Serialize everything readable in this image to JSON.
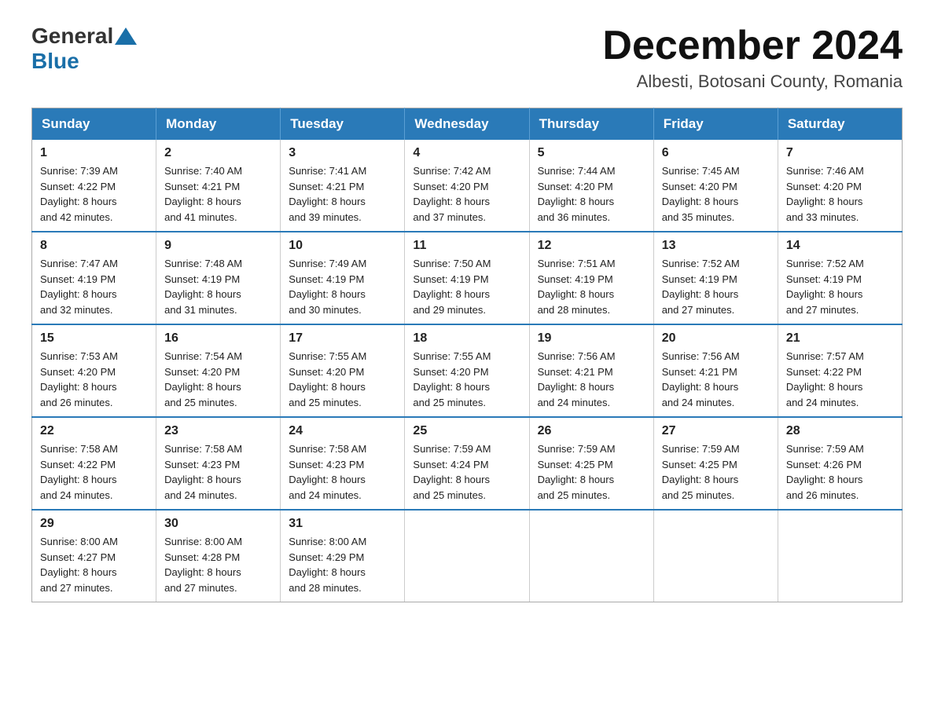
{
  "header": {
    "logo_general": "General",
    "logo_blue": "Blue",
    "month_title": "December 2024",
    "location": "Albesti, Botosani County, Romania"
  },
  "weekdays": [
    "Sunday",
    "Monday",
    "Tuesday",
    "Wednesday",
    "Thursday",
    "Friday",
    "Saturday"
  ],
  "weeks": [
    [
      {
        "day": "1",
        "sunrise": "7:39 AM",
        "sunset": "4:22 PM",
        "daylight": "8 hours and 42 minutes."
      },
      {
        "day": "2",
        "sunrise": "7:40 AM",
        "sunset": "4:21 PM",
        "daylight": "8 hours and 41 minutes."
      },
      {
        "day": "3",
        "sunrise": "7:41 AM",
        "sunset": "4:21 PM",
        "daylight": "8 hours and 39 minutes."
      },
      {
        "day": "4",
        "sunrise": "7:42 AM",
        "sunset": "4:20 PM",
        "daylight": "8 hours and 37 minutes."
      },
      {
        "day": "5",
        "sunrise": "7:44 AM",
        "sunset": "4:20 PM",
        "daylight": "8 hours and 36 minutes."
      },
      {
        "day": "6",
        "sunrise": "7:45 AM",
        "sunset": "4:20 PM",
        "daylight": "8 hours and 35 minutes."
      },
      {
        "day": "7",
        "sunrise": "7:46 AM",
        "sunset": "4:20 PM",
        "daylight": "8 hours and 33 minutes."
      }
    ],
    [
      {
        "day": "8",
        "sunrise": "7:47 AM",
        "sunset": "4:19 PM",
        "daylight": "8 hours and 32 minutes."
      },
      {
        "day": "9",
        "sunrise": "7:48 AM",
        "sunset": "4:19 PM",
        "daylight": "8 hours and 31 minutes."
      },
      {
        "day": "10",
        "sunrise": "7:49 AM",
        "sunset": "4:19 PM",
        "daylight": "8 hours and 30 minutes."
      },
      {
        "day": "11",
        "sunrise": "7:50 AM",
        "sunset": "4:19 PM",
        "daylight": "8 hours and 29 minutes."
      },
      {
        "day": "12",
        "sunrise": "7:51 AM",
        "sunset": "4:19 PM",
        "daylight": "8 hours and 28 minutes."
      },
      {
        "day": "13",
        "sunrise": "7:52 AM",
        "sunset": "4:19 PM",
        "daylight": "8 hours and 27 minutes."
      },
      {
        "day": "14",
        "sunrise": "7:52 AM",
        "sunset": "4:19 PM",
        "daylight": "8 hours and 27 minutes."
      }
    ],
    [
      {
        "day": "15",
        "sunrise": "7:53 AM",
        "sunset": "4:20 PM",
        "daylight": "8 hours and 26 minutes."
      },
      {
        "day": "16",
        "sunrise": "7:54 AM",
        "sunset": "4:20 PM",
        "daylight": "8 hours and 25 minutes."
      },
      {
        "day": "17",
        "sunrise": "7:55 AM",
        "sunset": "4:20 PM",
        "daylight": "8 hours and 25 minutes."
      },
      {
        "day": "18",
        "sunrise": "7:55 AM",
        "sunset": "4:20 PM",
        "daylight": "8 hours and 25 minutes."
      },
      {
        "day": "19",
        "sunrise": "7:56 AM",
        "sunset": "4:21 PM",
        "daylight": "8 hours and 24 minutes."
      },
      {
        "day": "20",
        "sunrise": "7:56 AM",
        "sunset": "4:21 PM",
        "daylight": "8 hours and 24 minutes."
      },
      {
        "day": "21",
        "sunrise": "7:57 AM",
        "sunset": "4:22 PM",
        "daylight": "8 hours and 24 minutes."
      }
    ],
    [
      {
        "day": "22",
        "sunrise": "7:58 AM",
        "sunset": "4:22 PM",
        "daylight": "8 hours and 24 minutes."
      },
      {
        "day": "23",
        "sunrise": "7:58 AM",
        "sunset": "4:23 PM",
        "daylight": "8 hours and 24 minutes."
      },
      {
        "day": "24",
        "sunrise": "7:58 AM",
        "sunset": "4:23 PM",
        "daylight": "8 hours and 24 minutes."
      },
      {
        "day": "25",
        "sunrise": "7:59 AM",
        "sunset": "4:24 PM",
        "daylight": "8 hours and 25 minutes."
      },
      {
        "day": "26",
        "sunrise": "7:59 AM",
        "sunset": "4:25 PM",
        "daylight": "8 hours and 25 minutes."
      },
      {
        "day": "27",
        "sunrise": "7:59 AM",
        "sunset": "4:25 PM",
        "daylight": "8 hours and 25 minutes."
      },
      {
        "day": "28",
        "sunrise": "7:59 AM",
        "sunset": "4:26 PM",
        "daylight": "8 hours and 26 minutes."
      }
    ],
    [
      {
        "day": "29",
        "sunrise": "8:00 AM",
        "sunset": "4:27 PM",
        "daylight": "8 hours and 27 minutes."
      },
      {
        "day": "30",
        "sunrise": "8:00 AM",
        "sunset": "4:28 PM",
        "daylight": "8 hours and 27 minutes."
      },
      {
        "day": "31",
        "sunrise": "8:00 AM",
        "sunset": "4:29 PM",
        "daylight": "8 hours and 28 minutes."
      },
      null,
      null,
      null,
      null
    ]
  ],
  "labels": {
    "sunrise": "Sunrise:",
    "sunset": "Sunset:",
    "daylight": "Daylight:"
  }
}
